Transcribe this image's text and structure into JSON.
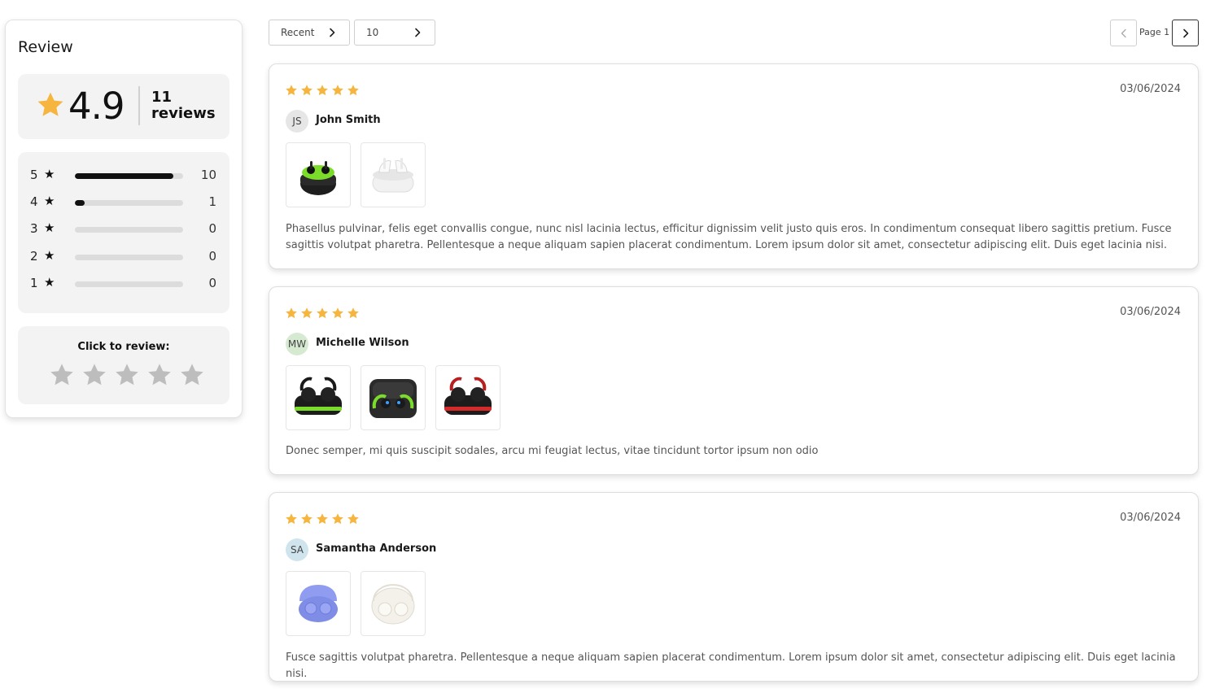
{
  "colors": {
    "star_filled": "#f5b53f",
    "star_empty": "#bdbdbd",
    "bar_fill": "#111111",
    "bar_track": "#dcdcdc",
    "panel_bg": "#f3f3f3"
  },
  "summary": {
    "title": "Review",
    "average": "4.9",
    "count_number": "11",
    "count_word": "reviews",
    "distribution": [
      {
        "stars": "5",
        "count": "10",
        "fraction": 0.91
      },
      {
        "stars": "4",
        "count": "1",
        "fraction": 0.09
      },
      {
        "stars": "3",
        "count": "0",
        "fraction": 0
      },
      {
        "stars": "2",
        "count": "0",
        "fraction": 0
      },
      {
        "stars": "1",
        "count": "0",
        "fraction": 0
      }
    ],
    "cta_label": "Click to review:",
    "cta_star_count": 5
  },
  "toolbar": {
    "sort_value": "Recent",
    "per_page_value": "10",
    "page_label": "Page 1"
  },
  "icons": {
    "star": "star-icon",
    "chevron_right": "chevron-right-icon",
    "chevron_left": "chevron-left-icon"
  },
  "reviews": [
    {
      "rating": 5,
      "date": "03/06/2024",
      "initials": "JS",
      "avatar_color": "#e6e6e6",
      "name": "John Smith",
      "images": [
        "earbuds-black-green-case",
        "earbuds-white-case"
      ],
      "text": "Phasellus pulvinar, felis eget convallis congue, nunc nisl lacinia lectus, efficitur dignissim velit justo quis eros. In condimentum consequat libero sagittis pretium. Fusce sagittis volutpat pharetra. Pellentesque a neque aliquam sapien placerat condimentum. Lorem ipsum dolor sit amet, consectetur adipiscing elit. Duis eget lacinia nisi."
    },
    {
      "rating": 5,
      "date": "03/06/2024",
      "initials": "MW",
      "avatar_color": "#d6ead2",
      "name": "Michelle Wilson",
      "images": [
        "sport-earbuds-green-case",
        "sport-earbuds-open-case",
        "sport-earbuds-red-case"
      ],
      "text": "Donec semper, mi quis suscipit sodales, arcu mi feugiat lectus, vitae tincidunt tortor ipsum non odio"
    },
    {
      "rating": 5,
      "date": "03/06/2024",
      "initials": "SA",
      "avatar_color": "#cfe4ec",
      "name": "Samantha Anderson",
      "images": [
        "earbuds-blue-case",
        "earbuds-ivory-case"
      ],
      "text": "Fusce sagittis volutpat pharetra. Pellentesque a neque aliquam sapien placerat condimentum. Lorem ipsum dolor sit amet, consectetur adipiscing elit. Duis eget lacinia nisi."
    }
  ]
}
